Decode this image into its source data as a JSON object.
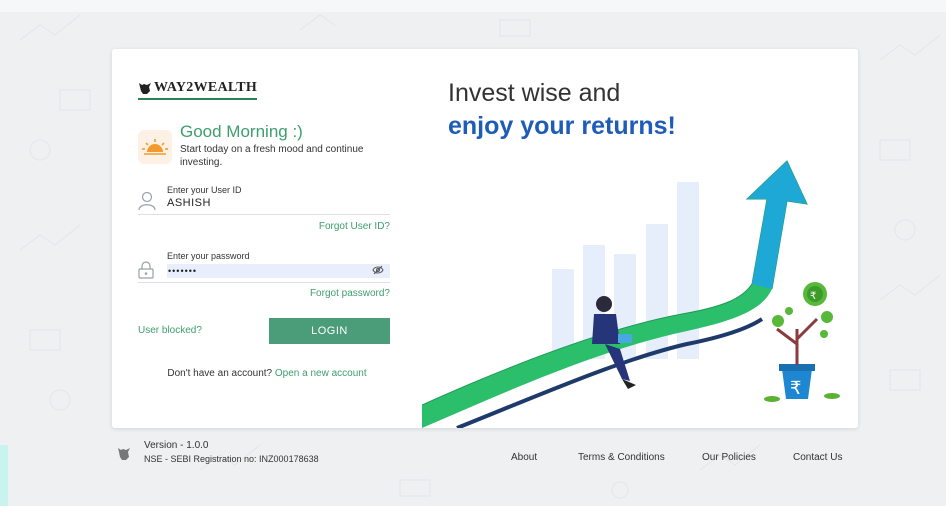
{
  "brand": {
    "logo_text": "WAY2WEALTH"
  },
  "greeting": {
    "title": "Good Morning :)",
    "subtitle": "Start today on a fresh mood and continue investing."
  },
  "userid": {
    "label": "Enter your User ID",
    "value": "ASHISH",
    "forgot": "Forgot User ID?"
  },
  "password": {
    "label": "Enter your password",
    "value": "•••••••",
    "forgot": "Forgot password?"
  },
  "actions": {
    "blocked": "User blocked?",
    "login": "LOGIN"
  },
  "signup": {
    "prompt": "Don't have an account?",
    "link": "Open a new account"
  },
  "hero": {
    "line1": "Invest wise and",
    "line2": "enjoy your returns!"
  },
  "footer": {
    "version": "Version - 1.0.0",
    "registration": "NSE - SEBI Registration no: INZ000178638",
    "links": [
      "About",
      "Terms & Conditions",
      "Our Policies",
      "Contact Us"
    ]
  },
  "colors": {
    "accent": "#3e9e6e",
    "button": "#4a9d78",
    "hero_blue": "#1e5cb8"
  }
}
